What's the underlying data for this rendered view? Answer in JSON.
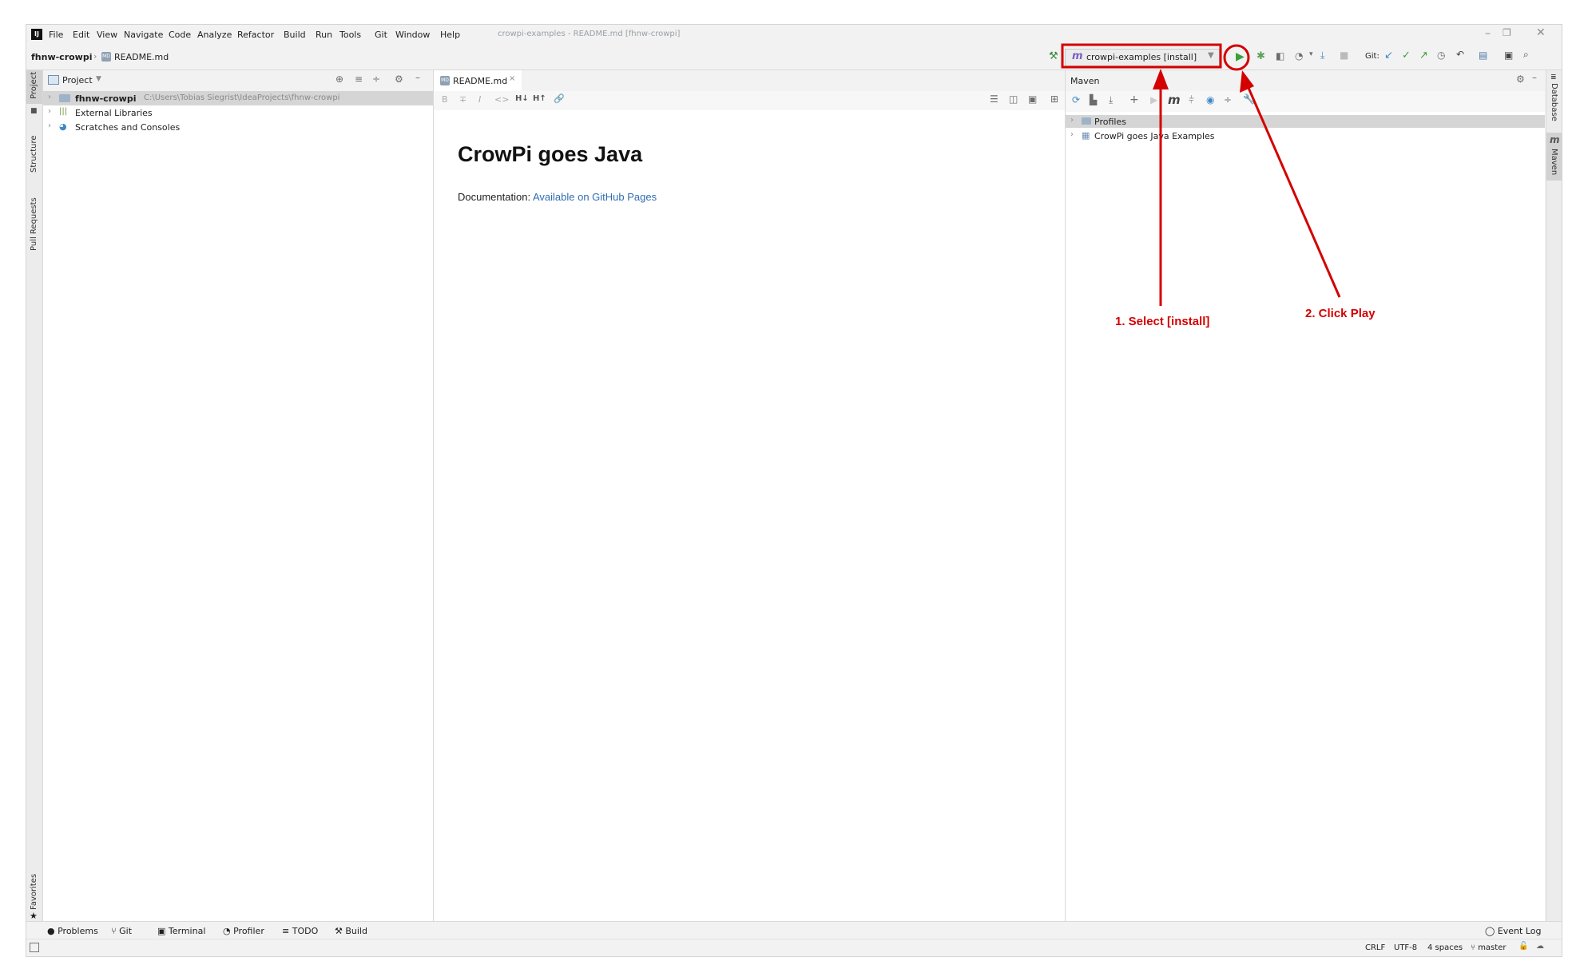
{
  "menubar": {
    "items": [
      "File",
      "Edit",
      "View",
      "Navigate",
      "Code",
      "Analyze",
      "Refactor",
      "Build",
      "Run",
      "Tools",
      "Git",
      "Window",
      "Help"
    ],
    "window_title": "crowpi-examples - README.md [fhnw-crowpi]"
  },
  "breadcrumb": {
    "project": "fhnw-crowpi",
    "file": "README.md"
  },
  "runconfig": {
    "label": "crowpi-examples [install]",
    "git_label": "Git:"
  },
  "project_panel": {
    "title": "Project",
    "tree": [
      {
        "name": "fhnw-crowpi",
        "path": "C:\\Users\\Tobias Siegrist\\IdeaProjects\\fhnw-crowpi"
      },
      {
        "name": "External Libraries"
      },
      {
        "name": "Scratches and Consoles"
      }
    ]
  },
  "left_tools": {
    "project": "Project",
    "structure": "Structure",
    "pull_requests": "Pull Requests",
    "favorites": "Favorites"
  },
  "right_tools": {
    "database": "Database",
    "maven": "Maven"
  },
  "editor": {
    "tab": "README.md",
    "heading": "CrowPi goes Java",
    "doc_label": "Documentation:",
    "doc_link": "Available on GitHub Pages",
    "toolbar": [
      "B",
      "∓",
      "I",
      "<>",
      "H↓",
      "H↑",
      "🔗"
    ]
  },
  "maven_panel": {
    "title": "Maven",
    "tree": [
      "Profiles",
      "CrowPi goes Java Examples"
    ]
  },
  "annotations": {
    "select": "1. Select [install]",
    "play": "2. Click Play",
    "color": "#d40000"
  },
  "bottom_tools": [
    "Problems",
    "Git",
    "Terminal",
    "Profiler",
    "TODO",
    "Build"
  ],
  "event_log": "Event Log",
  "status": {
    "line_sep": "CRLF",
    "encoding": "UTF-8",
    "indent": "4 spaces",
    "branch": "master"
  }
}
